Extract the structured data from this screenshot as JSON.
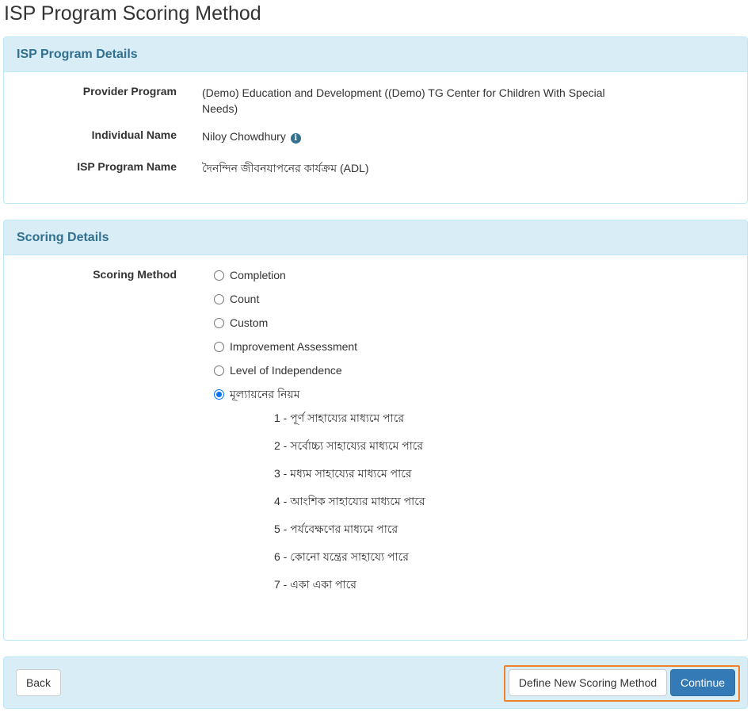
{
  "page_title": "ISP Program Scoring Method",
  "isp_panel": {
    "heading": "ISP Program Details",
    "fields": [
      {
        "label": "Provider Program",
        "value": "(Demo) Education and Development ((Demo) TG Center for Children With Special Needs)"
      },
      {
        "label": "Individual Name",
        "value": "Niloy Chowdhury"
      },
      {
        "label": "ISP Program Name",
        "value": "দৈনন্দিন জীবনযাপনের কার্যক্রম (ADL)"
      }
    ],
    "info_icon": "info-circle-icon"
  },
  "scoring_panel": {
    "heading": "Scoring Details",
    "label": "Scoring Method",
    "options": [
      {
        "label": "Completion",
        "checked": false
      },
      {
        "label": "Count",
        "checked": false
      },
      {
        "label": "Custom",
        "checked": false
      },
      {
        "label": "Improvement Assessment",
        "checked": false
      },
      {
        "label": "Level of Independence",
        "checked": false
      },
      {
        "label": "মূল্যায়নের নিয়ম",
        "checked": true
      }
    ],
    "levels": [
      "1 - পূর্ণ সাহায্যের মাধ্যমে পারে",
      "2 - সর্বোচ্চ্য সাহায্যের মাধ্যমে পারে",
      "3 - মধ্যম সাহায্যের মাধ্যমে পারে",
      "4 - আংশিক সাহায্যের মাধ্যমে পারে",
      "5 - পর্যবেক্ষণের মাধ্যমে পারে",
      "6 - কোনো যন্ত্রের সাহায্যে পারে",
      "7 - একা একা পারে"
    ]
  },
  "footer": {
    "back_label": "Back",
    "define_label": "Define New Scoring Method",
    "continue_label": "Continue"
  },
  "colors": {
    "panel_heading_bg": "#d9edf7",
    "panel_heading_text": "#31708f",
    "primary": "#337ab7",
    "highlight": "#f0822d"
  }
}
